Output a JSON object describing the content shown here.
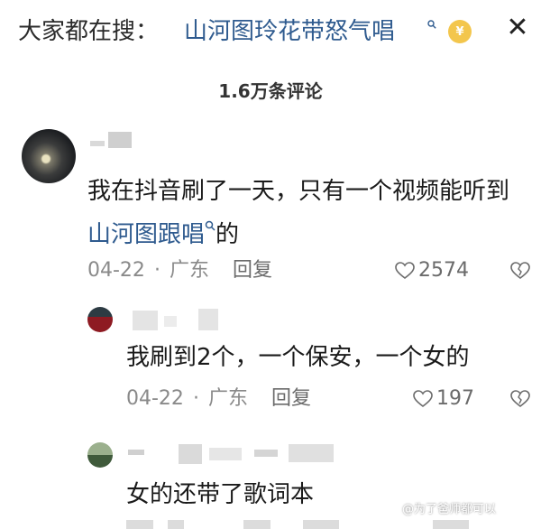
{
  "topbar": {
    "prefix": "大家都在搜：",
    "query": "山河图玲花带怒气唱",
    "coin_symbol": "¥",
    "close_label": "✕"
  },
  "comments_header": {
    "count_label": "1.6万条评论"
  },
  "comments": [
    {
      "text_before": "我在抖音刷了一天，只有一个视频能听到",
      "link": "山河图跟唱",
      "text_after": "的",
      "date": "04-22",
      "location": "广东",
      "reply_label": "回复",
      "likes": "2574"
    }
  ],
  "replies": [
    {
      "text": "我刷到2个，一个保安，一个女的",
      "date": "04-22",
      "location": "广东",
      "reply_label": "回复",
      "likes": "197"
    },
    {
      "text": "女的还带了歌词本"
    }
  ],
  "watermark": "@为了爸师都可以",
  "colors": {
    "link": "#2f5b8f",
    "meta": "#8a8a8a",
    "coin": "#f3c64d"
  }
}
